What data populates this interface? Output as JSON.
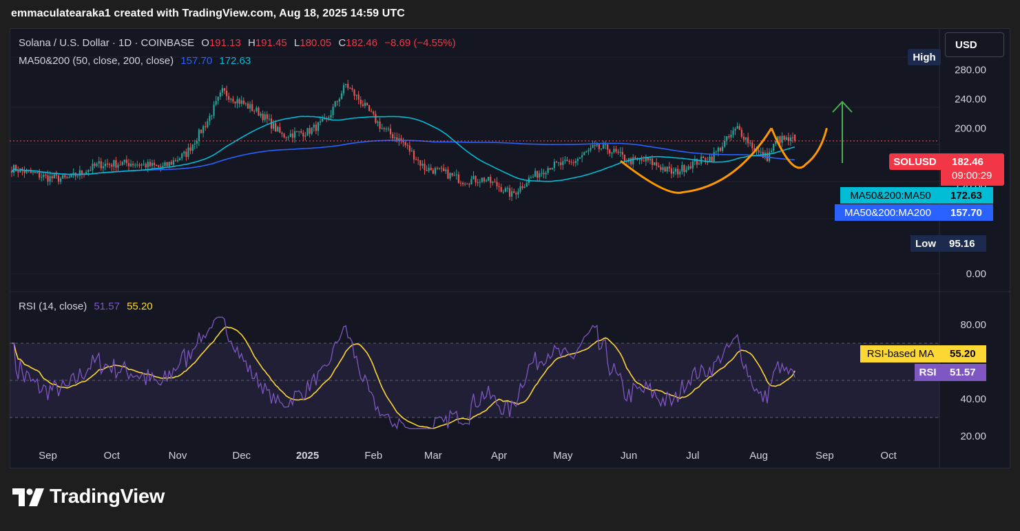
{
  "header": {
    "attribution": "emmaculatearaka1 created with TradingView.com, Aug 18, 2025 14:59 UTC"
  },
  "currency_button": "USD",
  "legend": {
    "symbol": "Solana / U.S. Dollar · 1D · COINBASE",
    "o_label": "O",
    "o_value": "191.13",
    "h_label": "H",
    "h_value": "191.45",
    "l_label": "L",
    "l_value": "180.05",
    "c_label": "C",
    "c_value": "182.46",
    "change": "−8.69 (−4.55%)",
    "ma_label": "MA50&200 (50, close, 200, close)",
    "ma50_value": "157.70",
    "ma200_value": "172.63"
  },
  "rsi_legend": {
    "label": "RSI (14, close)",
    "rsi_value": "51.57",
    "ma_value": "55.20"
  },
  "price_axis": {
    "ticks": [
      "280.00",
      "240.00",
      "200.00",
      "120.00",
      "0.00"
    ]
  },
  "rsi_axis": {
    "ticks": [
      "80.00",
      "40.00",
      "20.00"
    ]
  },
  "time_axis": {
    "labels": [
      "Sep",
      "Oct",
      "Nov",
      "Dec",
      "2025",
      "Feb",
      "Mar",
      "Apr",
      "May",
      "Jun",
      "Jul",
      "Aug",
      "Sep",
      "Oct"
    ]
  },
  "tags": {
    "high_label": "High",
    "symbol_tag": "SOLUSD",
    "price": "182.46",
    "countdown": "09:00:29",
    "ma50_tag": "MA50&200:MA50",
    "ma50_tag_value": "172.63",
    "ma200_tag": "MA50&200:MA200",
    "ma200_tag_value": "157.70",
    "low_label": "Low",
    "low_value": "95.16",
    "rsi_ma_tag": "RSI-based MA",
    "rsi_ma_value": "55.20",
    "rsi_tag": "RSI",
    "rsi_value": "51.57"
  },
  "colors": {
    "up": "#26a69a",
    "down": "#ef5350",
    "ma50": "#2962ff",
    "ma200": "#00bcd4",
    "rsi": "#7e57c2",
    "rsi_ma": "#fdd835",
    "pattern": "#ff9800",
    "arrow": "#4caf50"
  },
  "logo_text": "TradingView",
  "chart_data": {
    "type": "candlestick",
    "title": "Solana / U.S. Dollar · 1D · COINBASE",
    "months": [
      "Sep",
      "Oct",
      "Nov",
      "Dec",
      "2025",
      "Feb",
      "Mar",
      "Apr",
      "May",
      "Jun",
      "Jul",
      "Aug",
      "Sep",
      "Oct"
    ],
    "price_ylim": [
      0,
      290
    ],
    "close_anchors": {
      "dates": [
        "Aug 15",
        "Sep 1",
        "Sep 10",
        "Sep 25",
        "Oct 10",
        "Oct 25",
        "Nov 5",
        "Nov 15",
        "Nov 22",
        "Dec 1",
        "Dec 10",
        "Dec 20",
        "Jan 1",
        "Jan 10",
        "Jan 19",
        "Jan 25",
        "Feb 5",
        "Feb 15",
        "Feb 25",
        "Mar 5",
        "Mar 15",
        "Mar 25",
        "Apr 1",
        "Apr 7",
        "Apr 15",
        "Apr 25",
        "May 5",
        "May 15",
        "May 22",
        "Jun 1",
        "Jun 10",
        "Jun 22",
        "Jul 1",
        "Jul 10",
        "Jul 22",
        "Aug 1",
        "Aug 5",
        "Aug 10",
        "Aug 18"
      ],
      "values": [
        145,
        132,
        130,
        150,
        152,
        146,
        165,
        210,
        250,
        235,
        220,
        190,
        195,
        210,
        260,
        240,
        200,
        180,
        145,
        140,
        128,
        130,
        120,
        108,
        130,
        148,
        152,
        172,
        172,
        155,
        155,
        138,
        152,
        160,
        200,
        165,
        160,
        185,
        182
      ]
    },
    "last": {
      "open": 191.13,
      "high": 191.45,
      "low": 180.05,
      "close": 182.46,
      "change": -8.69,
      "change_pct": -4.55
    },
    "period_high": 294,
    "period_low": 95.16,
    "ma50_last": 172.63,
    "ma200_last": 157.7,
    "rsi": {
      "period": 14,
      "value": 51.57,
      "ma": 55.2,
      "ylim": [
        20,
        90
      ],
      "bands": [
        30,
        70
      ]
    }
  }
}
